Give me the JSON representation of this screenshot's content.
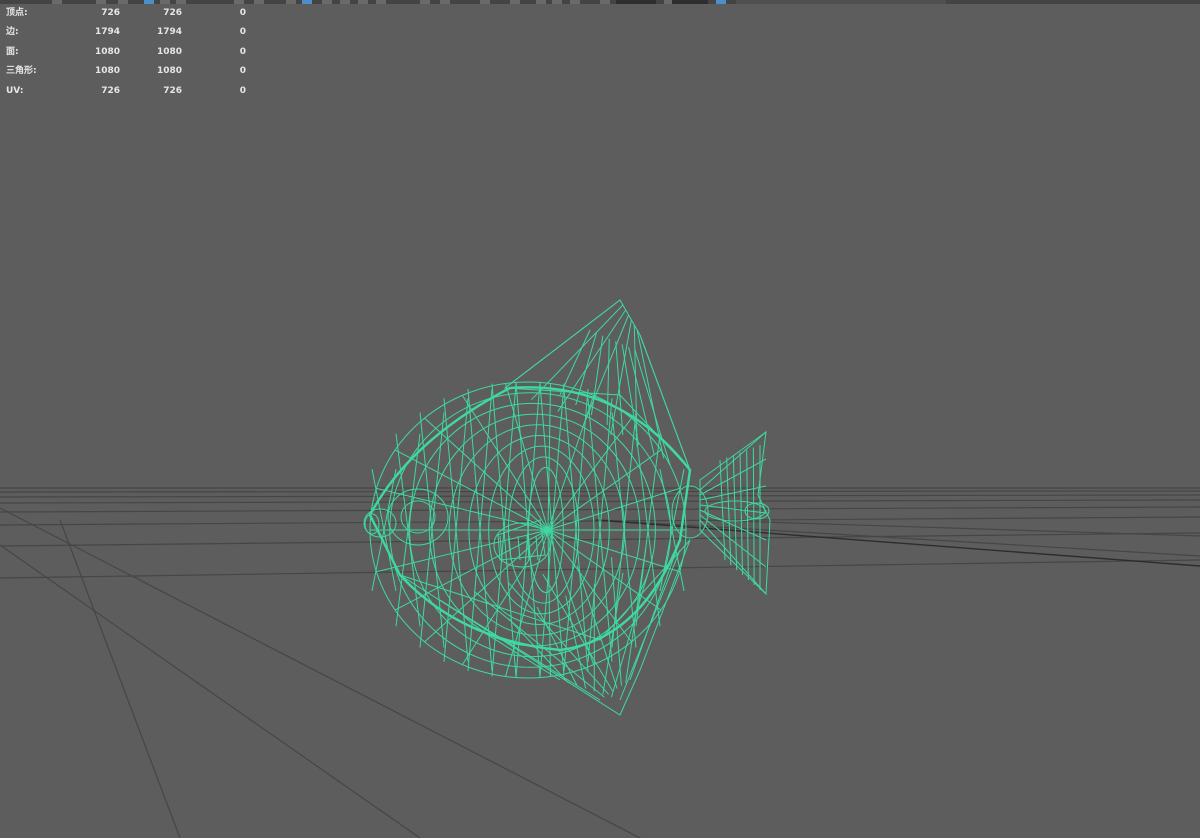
{
  "hud": {
    "rows": [
      {
        "label": "顶点:",
        "v1": "726",
        "v2": "726",
        "v3": "0"
      },
      {
        "label": "边:",
        "v1": "1794",
        "v2": "1794",
        "v3": "0"
      },
      {
        "label": "面:",
        "v1": "1080",
        "v2": "1080",
        "v3": "0"
      },
      {
        "label": "三角形:",
        "v1": "1080",
        "v2": "1080",
        "v3": "0"
      },
      {
        "label": "UV:",
        "v1": "726",
        "v2": "726",
        "v3": "0"
      }
    ]
  },
  "colors": {
    "background": "#5d5d5d",
    "wireframe": "#3fd9a0",
    "grid": "#464646",
    "hud_text": "#e6e6e6",
    "toolbar": "#444444",
    "toolbar_active": "#4d8fc9"
  },
  "icons": [
    "toolbar-icon",
    "select-mode-icon",
    "snap-icon"
  ]
}
